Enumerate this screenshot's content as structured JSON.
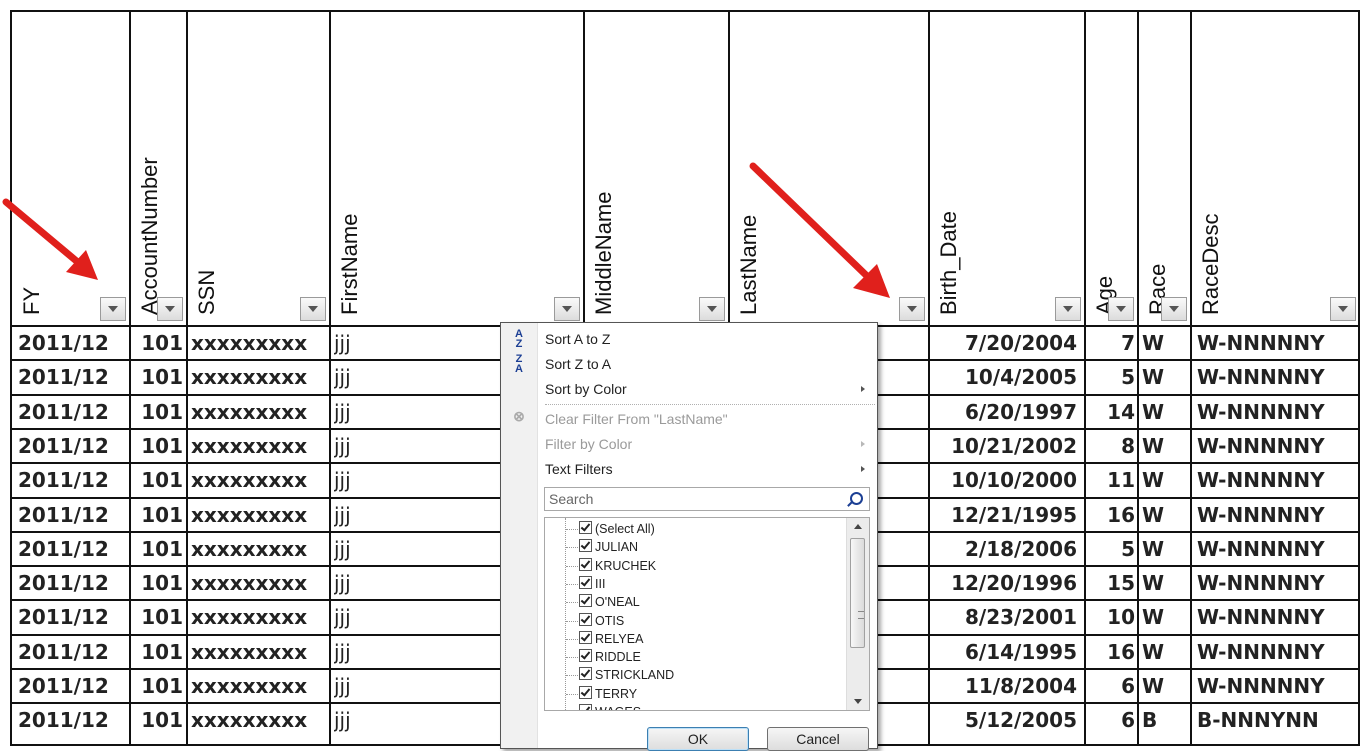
{
  "columns": [
    {
      "label": "FY",
      "key": "fy"
    },
    {
      "label": "AccountNumber",
      "key": "acct"
    },
    {
      "label": "SSN",
      "key": "ssn"
    },
    {
      "label": "FirstName",
      "key": "first"
    },
    {
      "label": "MiddleName",
      "key": "middle"
    },
    {
      "label": "LastName",
      "key": "last"
    },
    {
      "label": "Birth_Date",
      "key": "birth"
    },
    {
      "label": "Age",
      "key": "age"
    },
    {
      "label": "Race",
      "key": "race"
    },
    {
      "label": "RaceDesc",
      "key": "racedesc"
    }
  ],
  "rows": [
    {
      "fy": "2011/12",
      "acct": "101",
      "ssn": "xxxxxxxxx",
      "first": "jjj",
      "birth": "7/20/2004",
      "age": "7",
      "race": "W",
      "racedesc": "W-NNNNNY"
    },
    {
      "fy": "2011/12",
      "acct": "101",
      "ssn": "xxxxxxxxx",
      "first": "jjj",
      "birth": "10/4/2005",
      "age": "5",
      "race": "W",
      "racedesc": "W-NNNNNY"
    },
    {
      "fy": "2011/12",
      "acct": "101",
      "ssn": "xxxxxxxxx",
      "first": "jjj",
      "birth": "6/20/1997",
      "age": "14",
      "race": "W",
      "racedesc": "W-NNNNNY"
    },
    {
      "fy": "2011/12",
      "acct": "101",
      "ssn": "xxxxxxxxx",
      "first": "jjj",
      "birth": "10/21/2002",
      "age": "8",
      "race": "W",
      "racedesc": "W-NNNNNY"
    },
    {
      "fy": "2011/12",
      "acct": "101",
      "ssn": "xxxxxxxxx",
      "first": "jjj",
      "birth": "10/10/2000",
      "age": "11",
      "race": "W",
      "racedesc": "W-NNNNNY"
    },
    {
      "fy": "2011/12",
      "acct": "101",
      "ssn": "xxxxxxxxx",
      "first": "jjj",
      "birth": "12/21/1995",
      "age": "16",
      "race": "W",
      "racedesc": "W-NNNNNY"
    },
    {
      "fy": "2011/12",
      "acct": "101",
      "ssn": "xxxxxxxxx",
      "first": "jjj",
      "birth": "2/18/2006",
      "age": "5",
      "race": "W",
      "racedesc": "W-NNNNNY"
    },
    {
      "fy": "2011/12",
      "acct": "101",
      "ssn": "xxxxxxxxx",
      "first": "jjj",
      "birth": "12/20/1996",
      "age": "15",
      "race": "W",
      "racedesc": "W-NNNNNY"
    },
    {
      "fy": "2011/12",
      "acct": "101",
      "ssn": "xxxxxxxxx",
      "first": "jjj",
      "birth": "8/23/2001",
      "age": "10",
      "race": "W",
      "racedesc": "W-NNNNNY"
    },
    {
      "fy": "2011/12",
      "acct": "101",
      "ssn": "xxxxxxxxx",
      "first": "jjj",
      "birth": "6/14/1995",
      "age": "16",
      "race": "W",
      "racedesc": "W-NNNNNY"
    },
    {
      "fy": "2011/12",
      "acct": "101",
      "ssn": "xxxxxxxxx",
      "first": "jjj",
      "birth": "11/8/2004",
      "age": "6",
      "race": "W",
      "racedesc": "W-NNNNNY"
    },
    {
      "fy": "2011/12",
      "acct": "101",
      "ssn": "xxxxxxxxx",
      "first": "jjj",
      "birth": "5/12/2005",
      "age": "6",
      "race": "B",
      "racedesc": "B-NNNYNN"
    }
  ],
  "filter_menu": {
    "sort_a_z": "Sort A to Z",
    "sort_z_a": "Sort Z to A",
    "sort_by_color": "Sort by Color",
    "clear_filter": "Clear Filter From \"LastName\"",
    "filter_by_color": "Filter by Color",
    "text_filters": "Text Filters",
    "search_placeholder": "Search",
    "items": [
      "(Select All)",
      "JULIAN",
      "KRUCHEK",
      "III",
      "O'NEAL",
      "OTIS",
      "RELYEA",
      "RIDDLE",
      "STRICKLAND",
      "TERRY",
      "WAGES"
    ],
    "ok_label": "OK",
    "cancel_label": "Cancel"
  },
  "colors": {
    "annotation_arrow": "#e0201c",
    "grid": "#111111",
    "ok_border": "#3c7fb1"
  }
}
